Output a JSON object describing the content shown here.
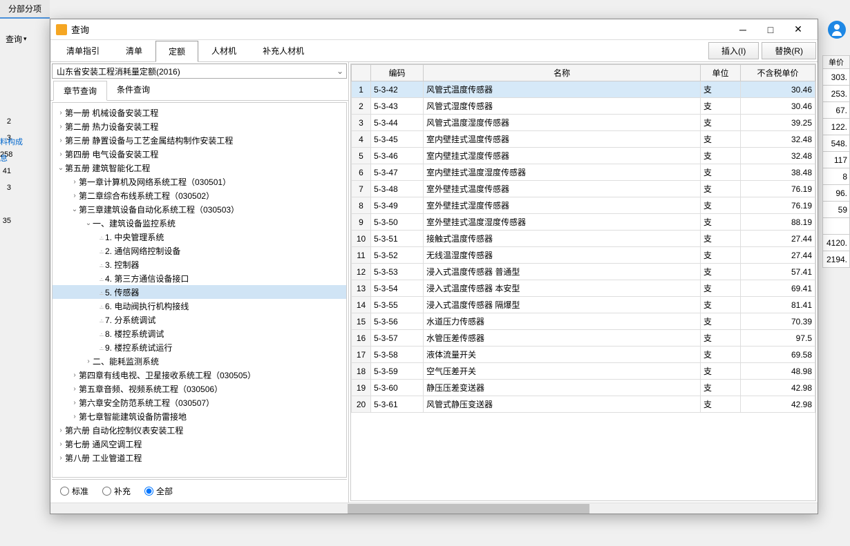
{
  "bg": {
    "tab": "分部分项",
    "query_btn": "查询",
    "right_header": "单价",
    "right_values": [
      "303.",
      "253.",
      "67.",
      "122.",
      "548.",
      "117",
      "8",
      "96.",
      "59",
      "",
      "4120.",
      "2194."
    ],
    "left_values": [
      "",
      "2",
      "3",
      "258",
      "41",
      "3",
      "",
      "35"
    ],
    "left_labels": [
      "料构成",
      "息"
    ]
  },
  "dialog": {
    "title": "查询",
    "min": "─",
    "max": "□",
    "close": "✕",
    "toolbar_tabs": [
      "清单指引",
      "清单",
      "定额",
      "人材机",
      "补充人材机"
    ],
    "toolbar_active": 2,
    "insert_btn": "插入(I)",
    "replace_btn": "替换(R)",
    "combo": "山东省安装工程消耗量定额(2016)",
    "query_tabs": [
      "章节查询",
      "条件查询"
    ],
    "query_active": 0,
    "radios": [
      "标准",
      "补充",
      "全部"
    ],
    "radio_selected": 2
  },
  "tree": [
    {
      "d": 0,
      "e": ">",
      "t": "第一册  机械设备安装工程"
    },
    {
      "d": 0,
      "e": ">",
      "t": "第二册  热力设备安装工程"
    },
    {
      "d": 0,
      "e": ">",
      "t": "第三册  静置设备与工艺金属结构制作安装工程"
    },
    {
      "d": 0,
      "e": ">",
      "t": "第四册  电气设备安装工程"
    },
    {
      "d": 0,
      "e": "v",
      "t": "第五册  建筑智能化工程"
    },
    {
      "d": 1,
      "e": ">",
      "t": "第一章计算机及网络系统工程（030501）"
    },
    {
      "d": 1,
      "e": ">",
      "t": "第二章综合布线系统工程（030502）"
    },
    {
      "d": 1,
      "e": "v",
      "t": "第三章建筑设备自动化系统工程（030503）"
    },
    {
      "d": 2,
      "e": "v",
      "t": "一、建筑设备监控系统"
    },
    {
      "d": 3,
      "e": ".",
      "t": "1. 中央管理系统"
    },
    {
      "d": 3,
      "e": ".",
      "t": "2. 通信网络控制设备"
    },
    {
      "d": 3,
      "e": ".",
      "t": "3. 控制器"
    },
    {
      "d": 3,
      "e": ".",
      "t": "4. 第三方通信设备接口"
    },
    {
      "d": 3,
      "e": ".",
      "t": "5. 传感器",
      "sel": true
    },
    {
      "d": 3,
      "e": ".",
      "t": "6. 电动阀执行机构接线"
    },
    {
      "d": 3,
      "e": ".",
      "t": "7. 分系统调试"
    },
    {
      "d": 3,
      "e": ".",
      "t": "8. 楼控系统调试"
    },
    {
      "d": 3,
      "e": ".",
      "t": "9. 楼控系统试运行"
    },
    {
      "d": 2,
      "e": ">",
      "t": "二、能耗监测系统"
    },
    {
      "d": 1,
      "e": ">",
      "t": "第四章有线电视、卫星接收系统工程（030505）"
    },
    {
      "d": 1,
      "e": ">",
      "t": "第五章音频、视频系统工程（030506）"
    },
    {
      "d": 1,
      "e": ">",
      "t": "第六章安全防范系统工程（030507）"
    },
    {
      "d": 1,
      "e": ">",
      "t": "第七章智能建筑设备防雷接地"
    },
    {
      "d": 0,
      "e": ">",
      "t": "第六册  自动化控制仪表安装工程"
    },
    {
      "d": 0,
      "e": ">",
      "t": "第七册  通风空调工程"
    },
    {
      "d": 0,
      "e": ">",
      "t": "第八册  工业管道工程"
    }
  ],
  "grid": {
    "headers": [
      "",
      "编码",
      "名称",
      "单位",
      "不含税单价"
    ],
    "rows": [
      {
        "n": 1,
        "code": "5-3-42",
        "name": "风管式温度传感器",
        "unit": "支",
        "price": "30.46",
        "sel": true
      },
      {
        "n": 2,
        "code": "5-3-43",
        "name": "风管式湿度传感器",
        "unit": "支",
        "price": "30.46"
      },
      {
        "n": 3,
        "code": "5-3-44",
        "name": "风管式温度湿度传感器",
        "unit": "支",
        "price": "39.25"
      },
      {
        "n": 4,
        "code": "5-3-45",
        "name": "室内壁挂式温度传感器",
        "unit": "支",
        "price": "32.48"
      },
      {
        "n": 5,
        "code": "5-3-46",
        "name": "室内壁挂式湿度传感器",
        "unit": "支",
        "price": "32.48"
      },
      {
        "n": 6,
        "code": "5-3-47",
        "name": "室内壁挂式温度湿度传感器",
        "unit": "支",
        "price": "38.48"
      },
      {
        "n": 7,
        "code": "5-3-48",
        "name": "室外壁挂式温度传感器",
        "unit": "支",
        "price": "76.19"
      },
      {
        "n": 8,
        "code": "5-3-49",
        "name": "室外壁挂式湿度传感器",
        "unit": "支",
        "price": "76.19"
      },
      {
        "n": 9,
        "code": "5-3-50",
        "name": "室外壁挂式温度湿度传感器",
        "unit": "支",
        "price": "88.19"
      },
      {
        "n": 10,
        "code": "5-3-51",
        "name": "接触式温度传感器",
        "unit": "支",
        "price": "27.44"
      },
      {
        "n": 11,
        "code": "5-3-52",
        "name": "无线温湿度传感器",
        "unit": "支",
        "price": "27.44"
      },
      {
        "n": 12,
        "code": "5-3-53",
        "name": "浸入式温度传感器  普通型",
        "unit": "支",
        "price": "57.41"
      },
      {
        "n": 13,
        "code": "5-3-54",
        "name": "浸入式温度传感器  本安型",
        "unit": "支",
        "price": "69.41"
      },
      {
        "n": 14,
        "code": "5-3-55",
        "name": "浸入式温度传感器  隔爆型",
        "unit": "支",
        "price": "81.41"
      },
      {
        "n": 15,
        "code": "5-3-56",
        "name": "水道压力传感器",
        "unit": "支",
        "price": "70.39"
      },
      {
        "n": 16,
        "code": "5-3-57",
        "name": "水管压差传感器",
        "unit": "支",
        "price": "97.5"
      },
      {
        "n": 17,
        "code": "5-3-58",
        "name": "液体流量开关",
        "unit": "支",
        "price": "69.58"
      },
      {
        "n": 18,
        "code": "5-3-59",
        "name": "空气压差开关",
        "unit": "支",
        "price": "48.98"
      },
      {
        "n": 19,
        "code": "5-3-60",
        "name": "静压压差变送器",
        "unit": "支",
        "price": "42.98"
      },
      {
        "n": 20,
        "code": "5-3-61",
        "name": "风管式静压变送器",
        "unit": "支",
        "price": "42.98"
      }
    ]
  }
}
